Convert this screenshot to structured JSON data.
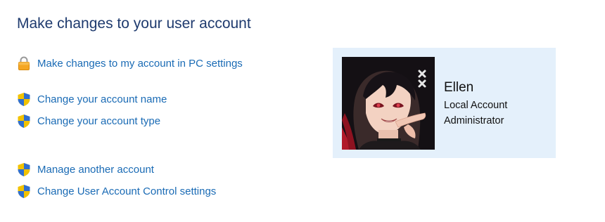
{
  "page": {
    "title": "Make changes to your user account"
  },
  "links": [
    {
      "label": "Make changes to my account in PC settings",
      "icon": "lock-icon"
    },
    {
      "label": "Change your account name",
      "icon": "uac-shield-icon"
    },
    {
      "label": "Change your account type",
      "icon": "uac-shield-icon"
    },
    {
      "label": "Manage another account",
      "icon": "uac-shield-icon"
    },
    {
      "label": "Change User Account Control settings",
      "icon": "uac-shield-icon"
    }
  ],
  "account": {
    "name": "Ellen",
    "type": "Local Account",
    "role": "Administrator",
    "avatar_icon": "user-avatar-anime-portrait"
  },
  "colors": {
    "title": "#1e3a6e",
    "link": "#1a6bb5",
    "card_background": "#e4f0fb",
    "lock": "#f5a623",
    "shield_blue": "#2f6fd1",
    "shield_yellow": "#f2c200"
  }
}
